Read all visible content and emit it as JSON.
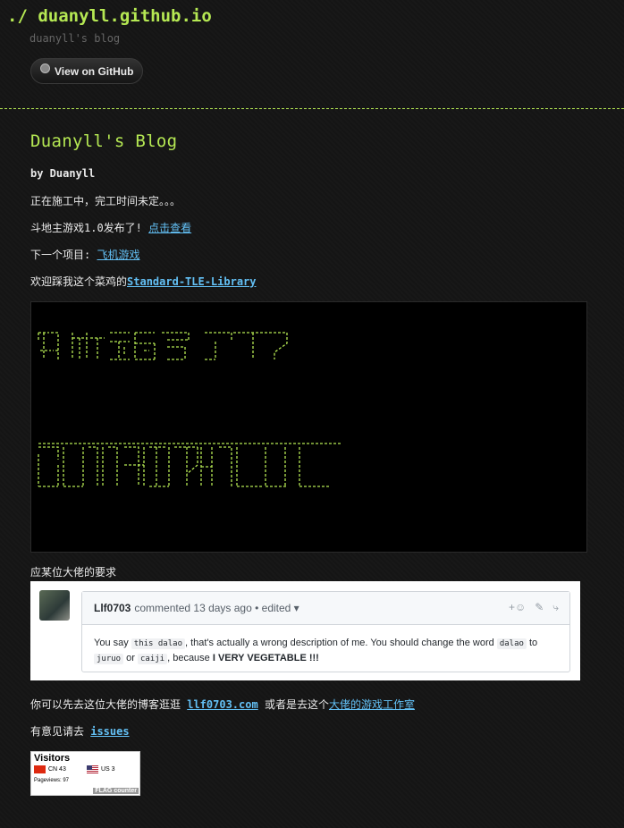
{
  "header": {
    "prefix": "./",
    "title": "duanyll.github.io",
    "subtitle": "duanyll's blog",
    "github_button": "View on GitHub"
  },
  "post": {
    "title": "Duanyll's Blog",
    "byline": "by Duanyll",
    "line1": "正在施工中，完工时间未定。。。",
    "line2_text": "斗地主游戏1.0发布了! ",
    "line2_link": "点击查看",
    "line3_text": "下一个项目: ",
    "line3_link": "飞机游戏",
    "line4_text": "欢迎踩我这个菜鸡的",
    "line4_link": "Standard-TLE-Library",
    "request_text": "应某位大佬的要求",
    "visit_text1": "你可以先去这位大佬的博客逛逛 ",
    "visit_link1": "llf0703.com",
    "visit_text2": " 或者是去这个",
    "visit_link2": "大佬的游戏工作室",
    "issues_text": "有意见请去 ",
    "issues_link": "issues"
  },
  "ascii_art": {
    "color": "#b5e853"
  },
  "comment": {
    "author": "Llf0703",
    "meta": "commented 13 days ago • edited ▾",
    "body_1": "You say ",
    "code_1": "this dalao",
    "body_2": ", that's actually a wrong description of me. You should change the word ",
    "code_2": "dalao",
    "body_3": " to",
    "code_3": "juruo",
    "body_4": " or ",
    "code_4": "caiji",
    "body_5": ", because ",
    "body_bold": "I VERY VEGETABLE !!!"
  },
  "counter": {
    "title": "Visitors",
    "cn": "CN 43",
    "us": "US 3",
    "pageviews": "Pageviews: 97",
    "brand": "FLAG counter"
  },
  "colors": {
    "accent": "#b5e853",
    "link": "#63c0f5",
    "background": "#151515"
  }
}
